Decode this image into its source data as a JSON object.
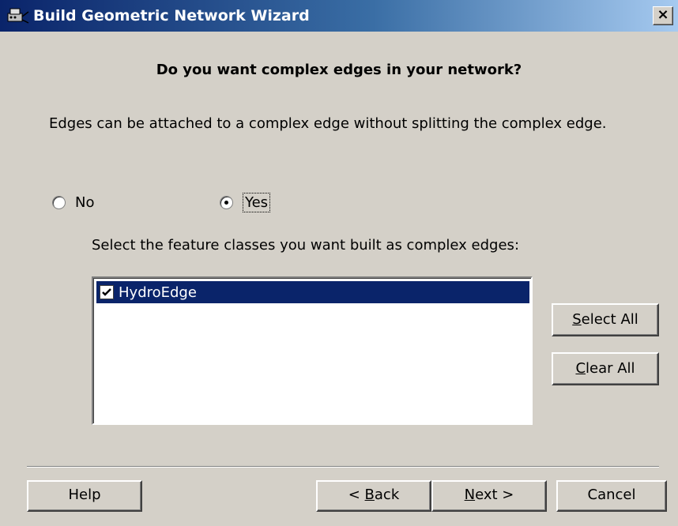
{
  "window": {
    "title": "Build Geometric Network Wizard",
    "close_label": "×"
  },
  "content": {
    "question": "Do you want complex edges in your network?",
    "description": "Edges can be attached to a complex edge without splitting the complex edge.",
    "radio_no": "No",
    "radio_yes": "Yes",
    "selected_option": "Yes",
    "list_label": "Select the feature classes you want built as complex edges:",
    "feature_classes": [
      {
        "name": "HydroEdge",
        "checked": true,
        "selected": true
      }
    ]
  },
  "buttons": {
    "select_all": {
      "mnemonic": "S",
      "rest": "elect All"
    },
    "clear_all": {
      "mnemonic": "C",
      "rest": "lear All"
    },
    "help": "Help",
    "back": {
      "prefix": "< ",
      "mnemonic": "B",
      "rest": "ack"
    },
    "next": {
      "mnemonic": "N",
      "rest": "ext >"
    },
    "cancel": "Cancel"
  },
  "colors": {
    "face": "#d4d0c8",
    "title_gradient_start": "#0a246a",
    "title_gradient_end": "#a6caf0",
    "selection": "#0a246a"
  }
}
